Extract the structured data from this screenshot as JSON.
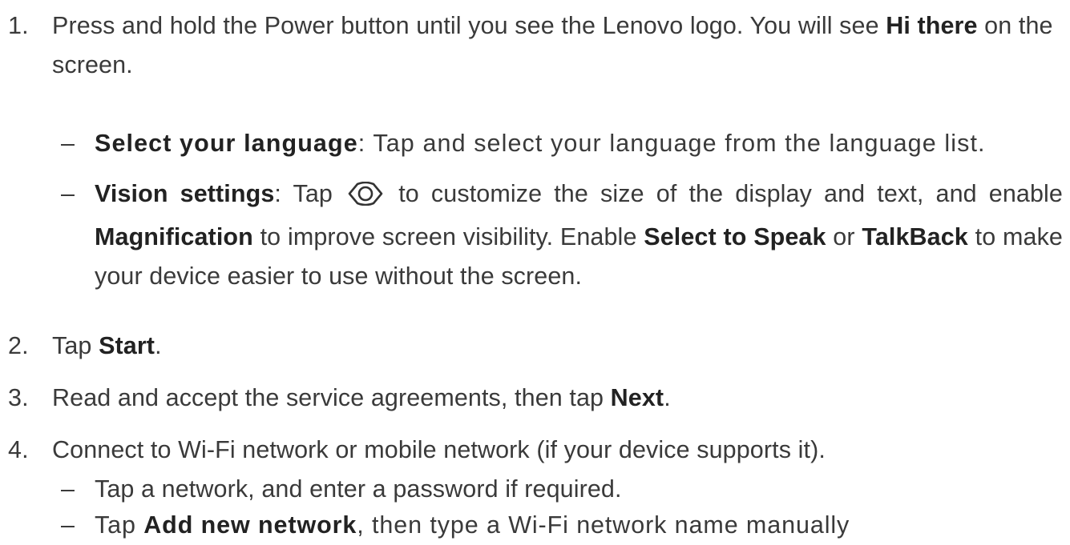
{
  "steps": [
    {
      "number": "1.",
      "parts": [
        {
          "t": "Press and hold the Power button until you see the Lenovo logo. You will see ",
          "b": false
        },
        {
          "t": "Hi there",
          "b": true
        },
        {
          "t": " on the screen.",
          "b": false
        }
      ],
      "subs": [
        {
          "dash": "–",
          "parts": [
            {
              "t": "Select your language",
              "b": true
            },
            {
              "t": ": Tap and select your language from the language list.",
              "b": false
            }
          ]
        },
        {
          "dash": "–",
          "parts": [
            {
              "t": "Vision settings",
              "b": true
            },
            {
              "t": ": Tap ",
              "b": false
            },
            {
              "icon": "eye-icon"
            },
            {
              "t": " to customize the size of the display and text, and enable ",
              "b": false
            },
            {
              "t": "Magnification",
              "b": true
            },
            {
              "t": " to improve screen visibility. Enable ",
              "b": false
            },
            {
              "t": "Select to Speak",
              "b": true
            },
            {
              "t": " or ",
              "b": false
            },
            {
              "t": "TalkBack",
              "b": true
            },
            {
              "t": " to make your device easier to use without the screen.",
              "b": false
            }
          ]
        }
      ]
    },
    {
      "number": "2.",
      "parts": [
        {
          "t": "Tap ",
          "b": false
        },
        {
          "t": "Start",
          "b": true
        },
        {
          "t": ".",
          "b": false
        }
      ],
      "subs": []
    },
    {
      "number": "3.",
      "parts": [
        {
          "t": "Read and accept the service agreements, then tap ",
          "b": false
        },
        {
          "t": "Next",
          "b": true
        },
        {
          "t": ".",
          "b": false
        }
      ],
      "subs": []
    },
    {
      "number": "4.",
      "parts": [
        {
          "t": "Connect to Wi-Fi network or mobile network (if your device supports it).",
          "b": false
        }
      ],
      "subs": [
        {
          "dash": "–",
          "parts": [
            {
              "t": "Tap a network, and enter a password if required.",
              "b": false
            }
          ]
        },
        {
          "dash": "–",
          "parts": [
            {
              "t": "Tap ",
              "b": false
            },
            {
              "t": "Add new network",
              "b": true
            },
            {
              "t": ", then type a Wi-Fi network name manually",
              "b": false
            }
          ]
        }
      ]
    }
  ]
}
